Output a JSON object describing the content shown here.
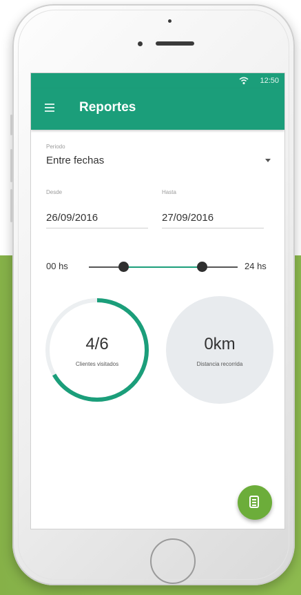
{
  "app": {
    "status_time": "12:50",
    "title": "Reportes"
  },
  "filters": {
    "period_label": "Periodo",
    "period_value": "Entre fechas",
    "from_label": "Desde",
    "from_value": "26/09/2016",
    "to_label": "Hasta",
    "to_value": "27/09/2016"
  },
  "hours_slider": {
    "min_label": "00 hs",
    "max_label": "24 hs"
  },
  "stats": {
    "visited": {
      "value": "4/6",
      "caption": "Clientes visitados",
      "progress": 0.6667
    },
    "distance": {
      "value": "0km",
      "caption": "Distancia recorrida"
    }
  },
  "icons": {
    "menu": "hamburger-menu-icon",
    "wifi": "wifi-icon",
    "dropdown": "chevron-down-icon",
    "fab": "report-document-icon"
  },
  "colors": {
    "primary": "#1b9e7a",
    "fab": "#6cad3a",
    "background_block": "#8dba4f"
  }
}
